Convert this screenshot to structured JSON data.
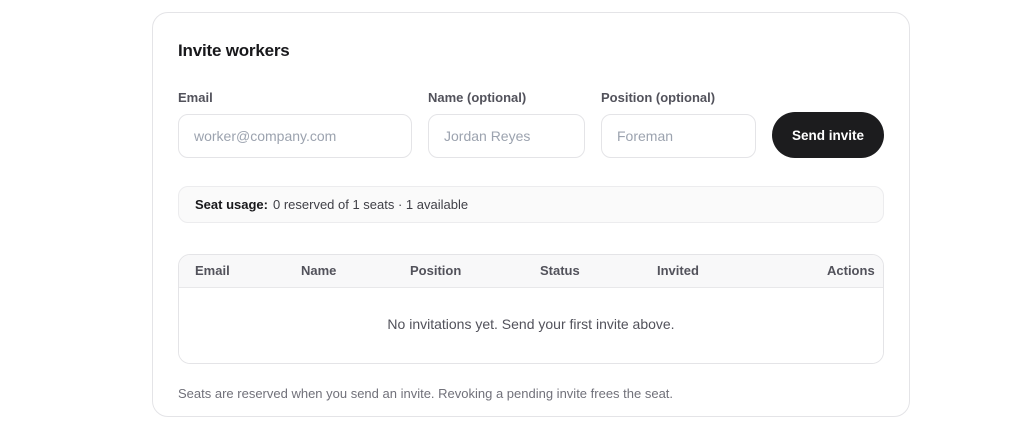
{
  "card": {
    "title": "Invite workers",
    "form": {
      "fields": [
        {
          "label": "Email",
          "placeholder": "worker@company.com"
        },
        {
          "label": "Name (optional)",
          "placeholder": "Jordan Reyes"
        },
        {
          "label": "Position (optional)",
          "placeholder": "Foreman"
        }
      ],
      "submit_label": "Send invite"
    },
    "seat_usage": {
      "label": "Seat usage:",
      "value": "0 reserved of 1 seats · 1 available"
    },
    "table": {
      "headers": [
        "Email",
        "Name",
        "Position",
        "Status",
        "Invited",
        "Actions"
      ],
      "rows": [],
      "empty_message": "No invitations yet. Send your first invite above."
    },
    "footnote": "Seats are reserved when you send an invite. Revoking a pending invite frees the seat."
  },
  "colors": {
    "card_border": "#e4e4e7",
    "button_bg": "#1c1c1e",
    "button_text": "#ffffff",
    "banner_bg": "#fafafa",
    "table_header_bg": "#f8f8f9",
    "muted_text": "#71717a"
  }
}
